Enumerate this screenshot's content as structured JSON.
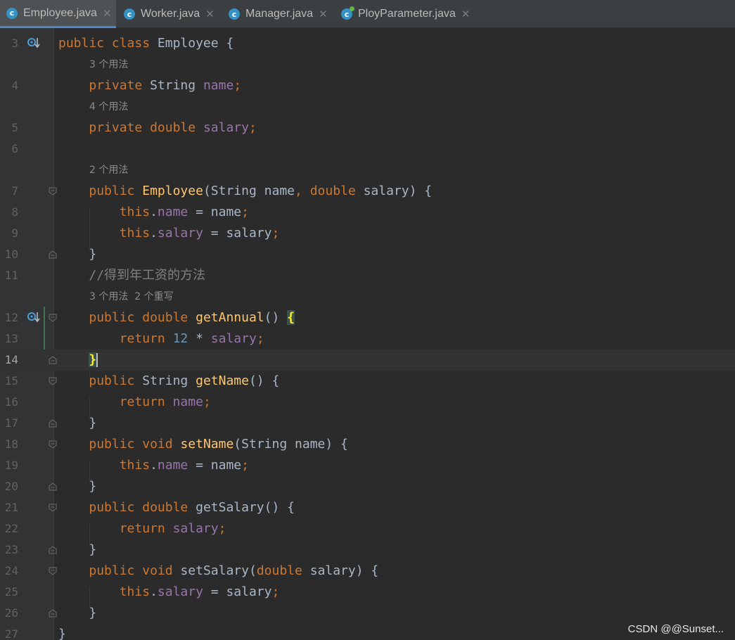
{
  "tabs": [
    {
      "label": "Employee.java",
      "active": true,
      "overridden": false
    },
    {
      "label": "Worker.java",
      "active": false,
      "overridden": false
    },
    {
      "label": "Manager.java",
      "active": false,
      "overridden": false
    },
    {
      "label": "PloyParameter.java",
      "active": false,
      "overridden": true
    }
  ],
  "editor": {
    "line_numbers": {
      "l3": "3",
      "l4": "4",
      "l5": "5",
      "l6": "6",
      "l7": "7",
      "l8": "8",
      "l9": "9",
      "l10": "10",
      "l11": "11",
      "l12": "12",
      "l13": "13",
      "l14": "14",
      "l15": "15",
      "l16": "16",
      "l17": "17",
      "l18": "18",
      "l19": "19",
      "l20": "20",
      "l21": "21",
      "l22": "22",
      "l23": "23",
      "l24": "24",
      "l25": "25",
      "l26": "26",
      "l27": "27"
    },
    "current_line": "14",
    "hints": {
      "name_usages": "3 个用法",
      "salary_usages": "4 个用法",
      "ctor_usages": "2 个用法",
      "annual_usages": "3 个用法",
      "annual_overrides": "2 个重写"
    },
    "code": {
      "public": "public",
      "class": "class",
      "private": "private",
      "double": "double",
      "void": "void",
      "this": "this",
      "return": "return",
      "String": "String",
      "Employee": "Employee",
      "name": "name",
      "salary": "salary",
      "number_12": "12",
      "getAnnual": "getAnnual",
      "getName": "getName",
      "setName": "setName",
      "getSalary": "getSalary",
      "setSalary": "setSalary",
      "comment_annual": "//得到年工资的方法"
    }
  },
  "colors": {
    "background": "#2b2b2b",
    "keyword": "#cc7832",
    "field": "#9876aa",
    "method": "#ffc66d",
    "number": "#6897bb",
    "text": "#a9b7c6",
    "comment": "#808080",
    "tab_icon": "#3592c4"
  },
  "watermark": "CSDN @@Sunset..."
}
